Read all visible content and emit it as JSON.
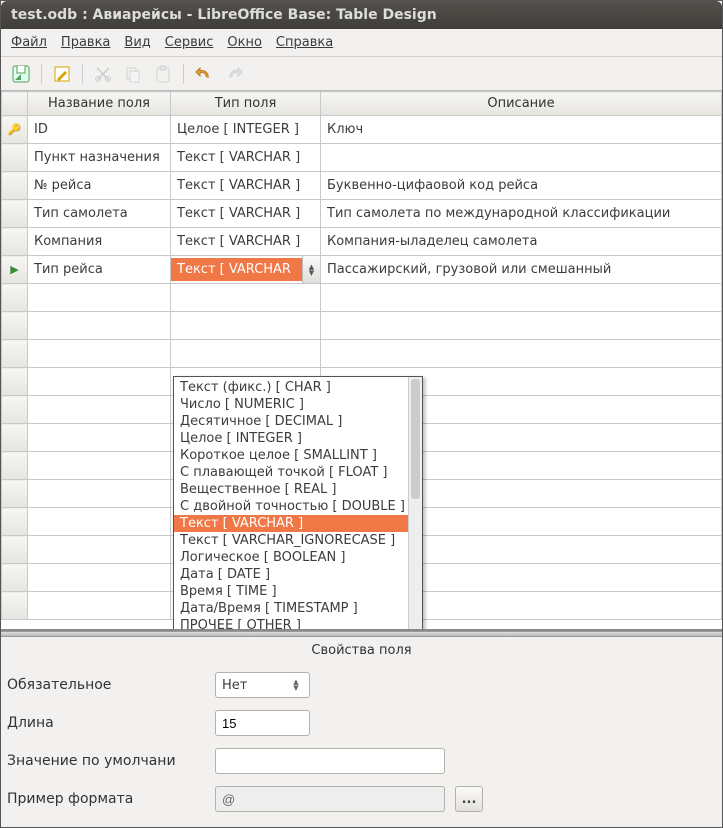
{
  "title": "test.odb : Авиарейсы - LibreOffice Base: Table Design",
  "menu": {
    "file": "Файл",
    "edit": "Правка",
    "view": "Вид",
    "tools": "Сервис",
    "window": "Окно",
    "help": "Справка"
  },
  "columns": {
    "name": "Название поля",
    "type": "Тип поля",
    "desc": "Описание"
  },
  "rows": [
    {
      "name": "ID",
      "type": "Целое [ INTEGER ]",
      "desc": "Ключ",
      "key": true
    },
    {
      "name": "Пункт назначения",
      "type": "Текст [ VARCHAR ]",
      "desc": ""
    },
    {
      "name": "№ рейса",
      "type": "Текст [ VARCHAR ]",
      "desc": "Буквенно-цифаовой код рейса"
    },
    {
      "name": "Тип самолета",
      "type": "Текст [ VARCHAR ]",
      "desc": "Тип самолета по международной классификации"
    },
    {
      "name": "Компания",
      "type": "Текст [ VARCHAR ]",
      "desc": "Компания-ыладелец самолета"
    },
    {
      "name": "Тип рейса",
      "type": "Текст [ VARCHAR",
      "desc": "Пассажирский, грузовой или смешанный",
      "current": true,
      "editing": true
    }
  ],
  "type_options": [
    "Текст (фикс.) [ CHAR ]",
    "Число [ NUMERIC ]",
    "Десятичное [ DECIMAL ]",
    "Целое [ INTEGER ]",
    "Короткое целое [ SMALLINT ]",
    "С плавающей точкой [ FLOAT ]",
    "Вещественное [ REAL ]",
    "С двойной точностью [ DOUBLE ]",
    "Текст [ VARCHAR ]",
    "Текст [ VARCHAR_IGNORECASE ]",
    "Логическое [ BOOLEAN ]",
    "Дата [ DATE ]",
    "Время [ TIME ]",
    "Дата/Время [ TIMESTAMP ]",
    "ПРОЧЕЕ [ OTHER ]"
  ],
  "type_selected_index": 8,
  "props": {
    "title": "Свойства поля",
    "required_label": "Обязательное",
    "required_value": "Нет",
    "length_label": "Длина",
    "length_value": "15",
    "default_label": "Значение по умолчани",
    "default_value": "",
    "format_label": "Пример формата",
    "format_value": "@",
    "format_btn": "..."
  }
}
